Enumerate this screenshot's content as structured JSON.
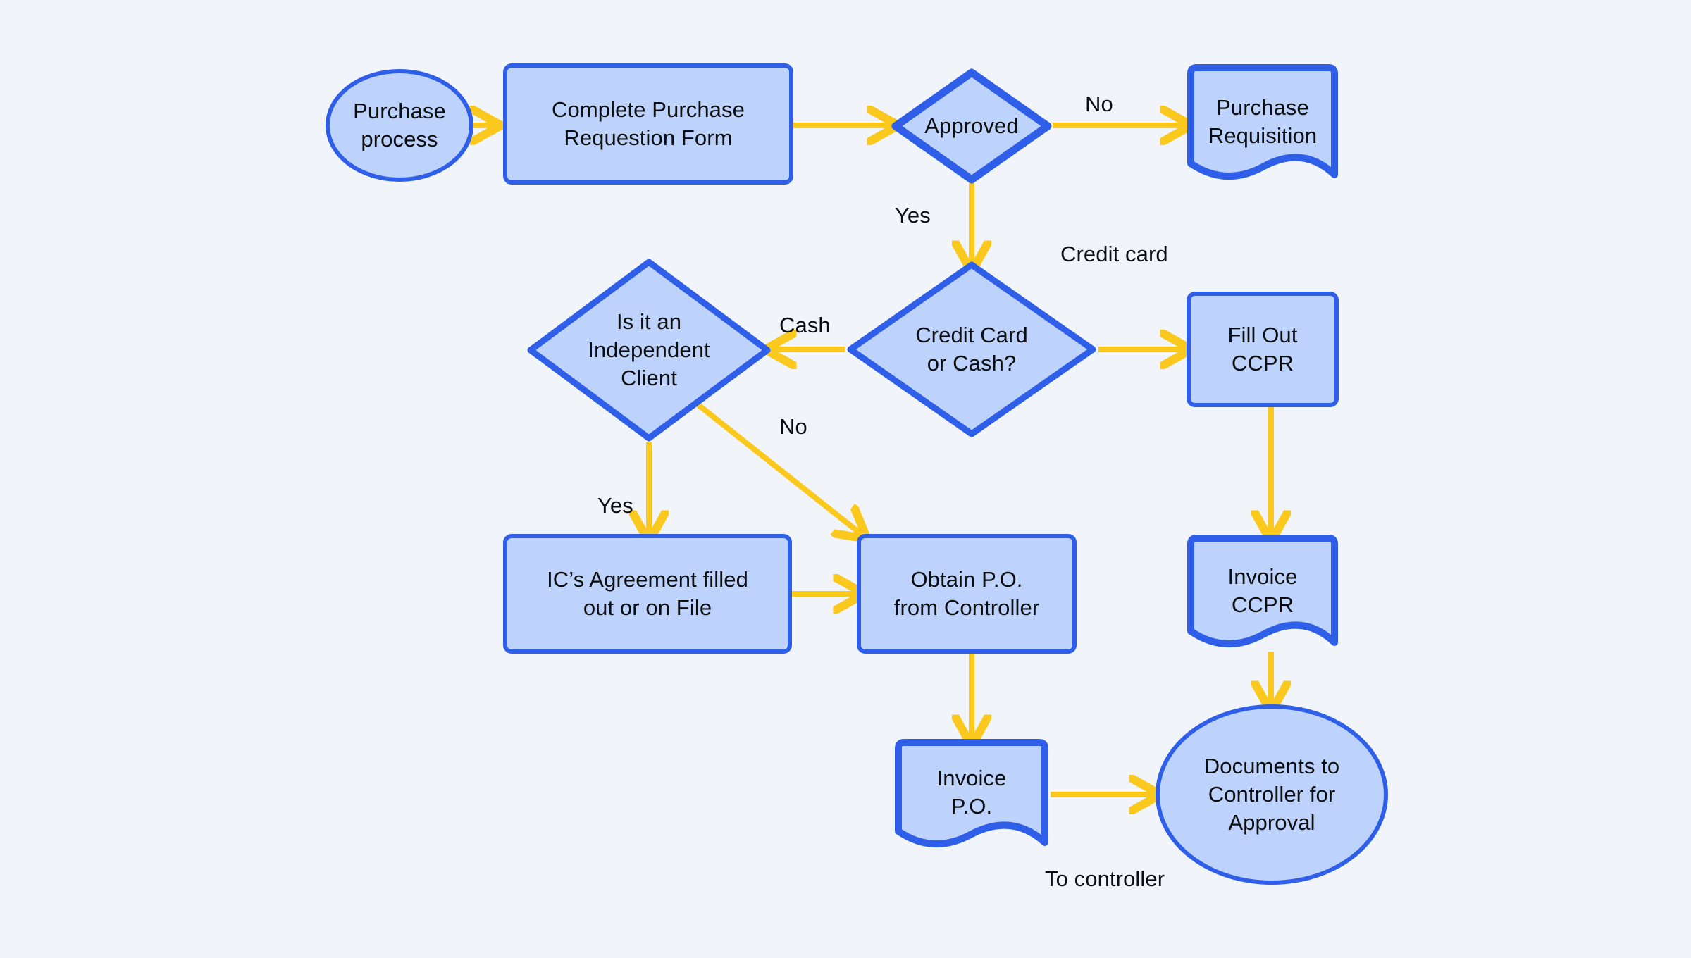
{
  "diagram": {
    "title": "Purchase process flowchart",
    "colors": {
      "background": "#f1f5fa",
      "node_fill": "#bdd3fb",
      "node_stroke": "#2f5fe8",
      "connector": "#fbc81e",
      "text": "#0b0d10"
    },
    "nodes": [
      {
        "id": "start",
        "shape": "ellipse",
        "label": "Purchase\nprocess"
      },
      {
        "id": "complete_pr",
        "shape": "process",
        "label": "Complete Purchase\nRequestion Form"
      },
      {
        "id": "approved",
        "shape": "decision",
        "label": "Approved"
      },
      {
        "id": "purchase_req",
        "shape": "document",
        "label": "Purchase\nRequisition"
      },
      {
        "id": "cc_or_cash",
        "shape": "decision",
        "label": "Credit Card\nor Cash?"
      },
      {
        "id": "independent",
        "shape": "decision",
        "label": "Is it an\nIndependent\nClient"
      },
      {
        "id": "fill_ccpr",
        "shape": "process",
        "label": "Fill Out\nCCPR"
      },
      {
        "id": "ic_agreement",
        "shape": "process",
        "label": "IC’s Agreement filled\nout or on File"
      },
      {
        "id": "obtain_po",
        "shape": "process",
        "label": "Obtain P.O.\nfrom Controller"
      },
      {
        "id": "invoice_ccpr",
        "shape": "document",
        "label": "Invoice\nCCPR"
      },
      {
        "id": "invoice_po",
        "shape": "document",
        "label": "Invoice\nP.O."
      },
      {
        "id": "docs_ctrl",
        "shape": "ellipse",
        "label": "Documents to\nController for\nApproval"
      }
    ],
    "edge_labels": [
      {
        "id": "no_approved",
        "text": "No"
      },
      {
        "id": "yes_approved",
        "text": "Yes"
      },
      {
        "id": "credit_card",
        "text": "Credit card"
      },
      {
        "id": "cash",
        "text": "Cash"
      },
      {
        "id": "no_independent",
        "text": "No"
      },
      {
        "id": "yes_independent",
        "text": "Yes"
      },
      {
        "id": "to_controller",
        "text": "To controller"
      }
    ]
  }
}
